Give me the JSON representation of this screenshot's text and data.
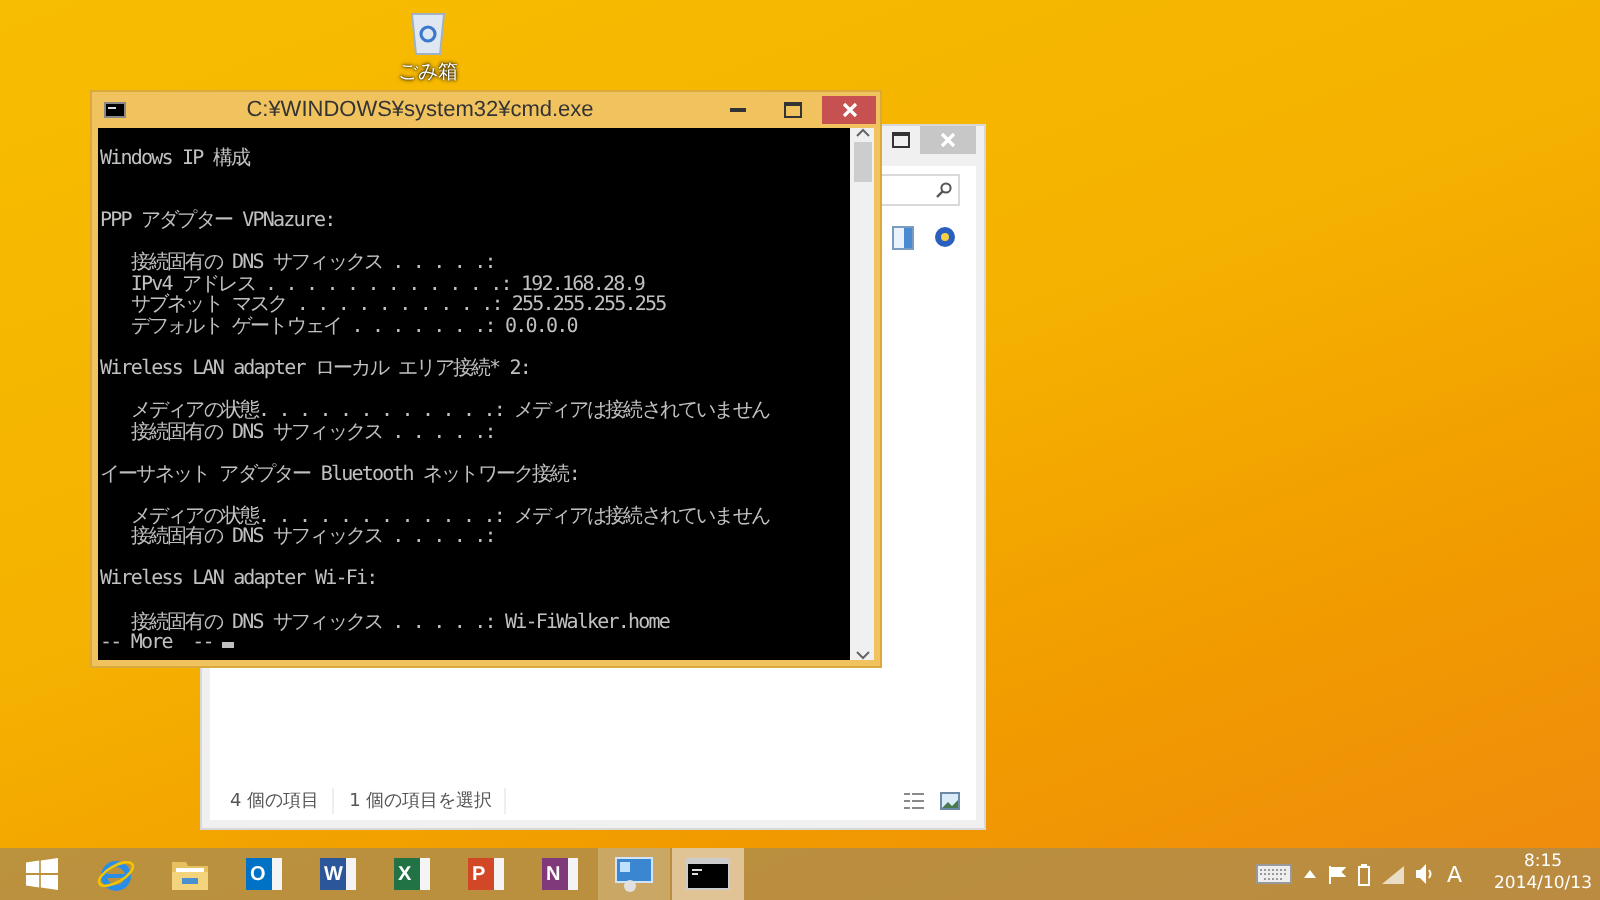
{
  "desktop": {
    "icons": [
      {
        "kind": "recycle-bin",
        "label": "ごみ箱"
      }
    ]
  },
  "explorer_window": {
    "status_bar": {
      "item_count": "4 個の項目",
      "selection": "1 個の項目を選択"
    }
  },
  "cmd_window": {
    "title": "C:¥WINDOWS¥system32¥cmd.exe",
    "sections": [
      {
        "heading": "Windows IP 構成"
      },
      {
        "heading": "PPP アダプター VPNazure:",
        "entries": [
          "   接続固有の DNS サフィックス . . . . .:",
          "   IPv4 アドレス . . . . . . . . . . . .: 192.168.28.9",
          "   サブネット マスク . . . . . . . . . .: 255.255.255.255",
          "   デフォルト ゲートウェイ . . . . . . .: 0.0.0.0"
        ]
      },
      {
        "heading": "Wireless LAN adapter ローカル エリア接続* 2:",
        "entries": [
          "   メディアの状態. . . . . . . . . . . .: メディアは接続されていません",
          "   接続固有の DNS サフィックス . . . . .:"
        ]
      },
      {
        "heading": "イーサネット アダプター Bluetooth ネットワーク接続:",
        "entries": [
          "   メディアの状態. . . . . . . . . . . .: メディアは接続されていません",
          "   接続固有の DNS サフィックス . . . . .:"
        ]
      },
      {
        "heading": "Wireless LAN adapter Wi-Fi:",
        "entries": [
          "   接続固有の DNS サフィックス . . . . .: Wi-FiWalker.home"
        ]
      }
    ],
    "prompt": "-- More  -- "
  },
  "taskbar": {
    "apps": [
      {
        "kind": "start",
        "selected": false
      },
      {
        "kind": "browser",
        "selected": false
      },
      {
        "kind": "folder",
        "selected": false
      },
      {
        "kind": "office",
        "letter": "O",
        "color": "#0072c6",
        "selected": false
      },
      {
        "kind": "office",
        "letter": "W",
        "color": "#2b579a",
        "selected": false
      },
      {
        "kind": "office",
        "letter": "X",
        "color": "#217346",
        "selected": false
      },
      {
        "kind": "office",
        "letter": "P",
        "color": "#d24726",
        "selected": false
      },
      {
        "kind": "office",
        "letter": "N",
        "color": "#80397b",
        "selected": false
      },
      {
        "kind": "remote",
        "running": true,
        "selected": false
      },
      {
        "kind": "console",
        "running": true,
        "selected": true
      }
    ],
    "tray": {
      "ime": "A",
      "time": "8:15",
      "date": "2014/10/13"
    }
  }
}
